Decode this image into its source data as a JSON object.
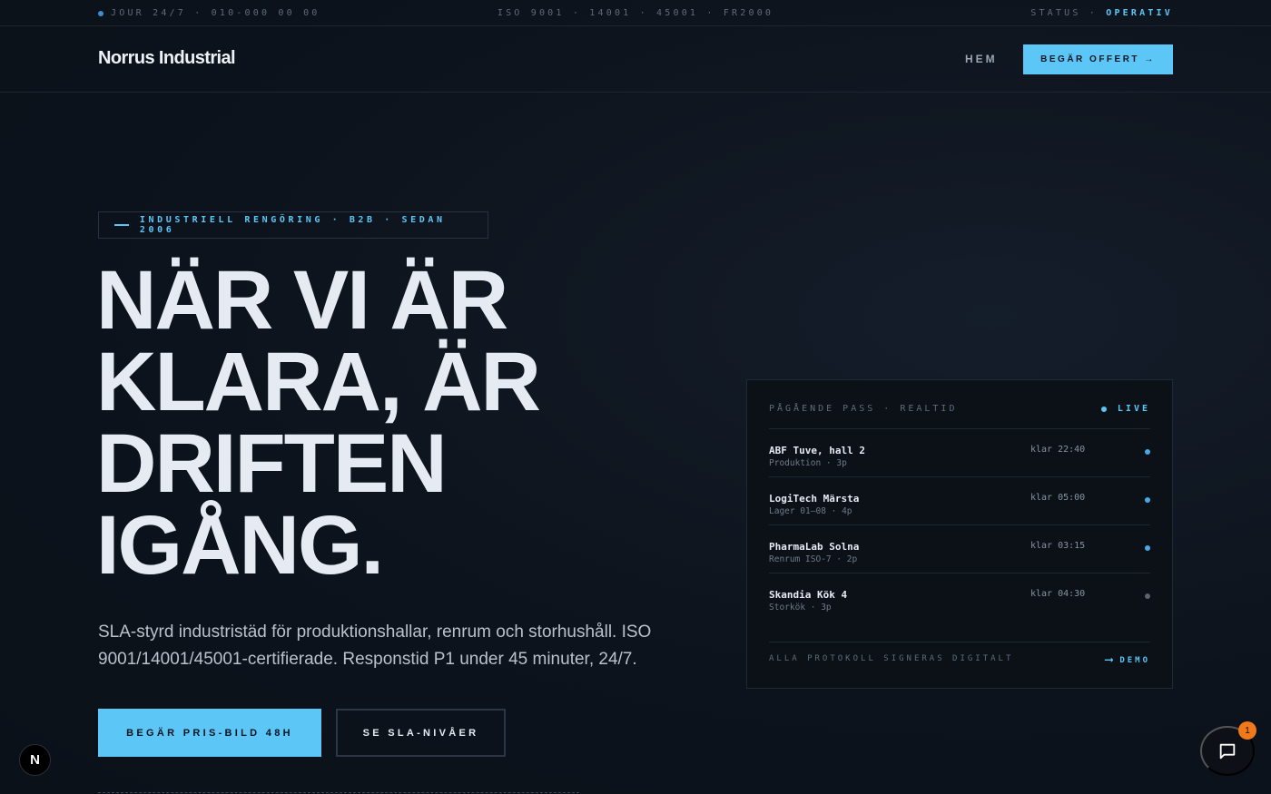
{
  "topbar": {
    "left": "JOUR 24/7 · 010-000 00 00",
    "center": "ISO 9001 · 14001 · 45001 · FR2000",
    "status_label": "STATUS ·",
    "status_value": "OPERATIV"
  },
  "nav": {
    "brand": "Norrus Industrial",
    "home": "HEM",
    "cta": "BEGÄR OFFERT →"
  },
  "hero": {
    "kicker": "INDUSTRIELL RENGÖRING · B2B · SEDAN 2006",
    "headline": [
      "NÄR VI ÄR",
      "KLARA, ÄR",
      "DRIFTEN",
      "IGÅNG."
    ],
    "lead": "SLA-styrd industristäd för produktionshallar, renrum och storhushåll. ISO 9001/14001/45001-certifierade. Responstid P1 under 45 minuter, 24/7.",
    "btn_primary": "BEGÄR PRIS-BILD 48H",
    "btn_secondary": "SE SLA-NIVÅER"
  },
  "panel": {
    "title": "PÅGÅENDE PASS · REALTID",
    "live": "LIVE",
    "rows": [
      {
        "name": "ABF Tuve, hall 2",
        "sub": "Produktion · 3p",
        "time": "klar 22:40",
        "status_color": "#4aa8e8"
      },
      {
        "name": "LogiTech Märsta",
        "sub": "Lager 01–08 · 4p",
        "time": "klar 05:00",
        "status_color": "#4aa8e8"
      },
      {
        "name": "PharmaLab Solna",
        "sub": "Renrum ISO-7 · 2p",
        "time": "klar 03:15",
        "status_color": "#4aa8e8"
      },
      {
        "name": "Skandia Kök 4",
        "sub": "Storkök · 3p",
        "time": "klar 04:30",
        "status_color": "#5b6370"
      }
    ],
    "footer": "ALLA PROTOKOLL SIGNERAS DIGITALT",
    "demo": "DEMO"
  },
  "floating": {
    "n_badge": "N",
    "chat_count": "1"
  },
  "colors": {
    "accent": "#5cc6f7",
    "background": "#0d131c",
    "badge": "#f07a1a"
  }
}
